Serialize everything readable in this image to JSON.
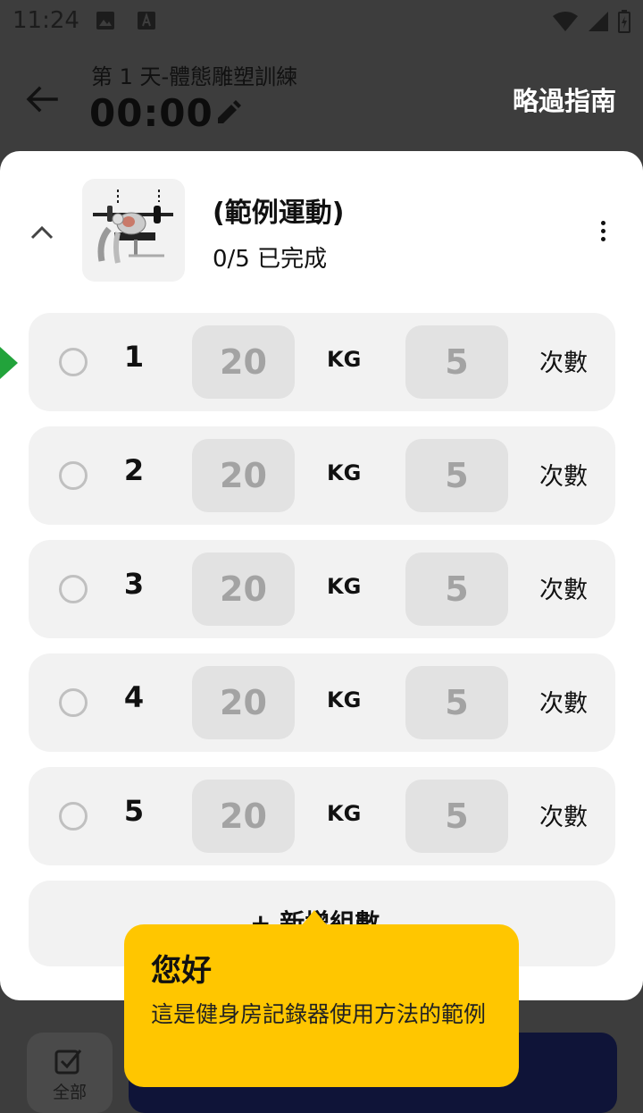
{
  "status_bar": {
    "time": "11:24"
  },
  "header": {
    "workout_title": "第 1 天-體態雕塑訓練",
    "timer": "00:00",
    "skip_label": "略過指南"
  },
  "exercise": {
    "name": "(範例運動)",
    "progress": "0/5 已完成",
    "help": "?"
  },
  "sets": [
    {
      "number": "1",
      "weight": "20",
      "unit": "KG",
      "reps": "5",
      "reps_unit": "次數"
    },
    {
      "number": "2",
      "weight": "20",
      "unit": "KG",
      "reps": "5",
      "reps_unit": "次數"
    },
    {
      "number": "3",
      "weight": "20",
      "unit": "KG",
      "reps": "5",
      "reps_unit": "次數"
    },
    {
      "number": "4",
      "weight": "20",
      "unit": "KG",
      "reps": "5",
      "reps_unit": "次數"
    },
    {
      "number": "5",
      "weight": "20",
      "unit": "KG",
      "reps": "5",
      "reps_unit": "次數"
    }
  ],
  "add_set_label": "+ 新增組數",
  "tooltip": {
    "title": "您好",
    "body": "這是健身房記錄器使用方法的範例"
  },
  "bottom": {
    "filter_label": "全部"
  },
  "colors": {
    "accent_yellow": "#ffc600",
    "active_green": "#22a33b",
    "primary_navy": "#0f1438"
  }
}
